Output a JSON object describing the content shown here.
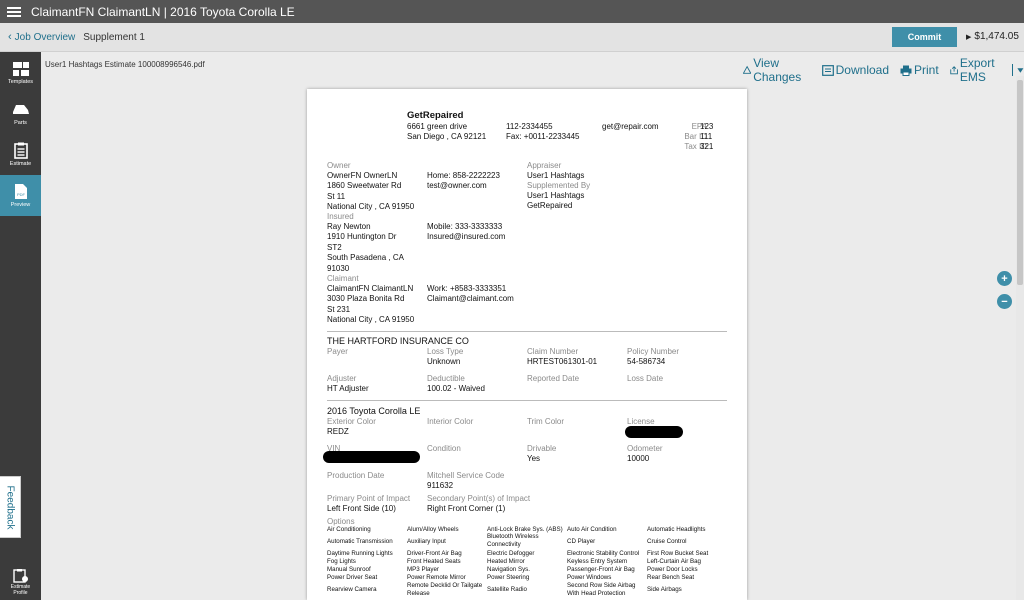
{
  "topbar": {
    "menu_icon": "hamburger-icon",
    "title": "ClaimantFN ClaimantLN | 2016 Toyota Corolla LE"
  },
  "subheader": {
    "back_label": "Job Overview",
    "supplement": "Supplement 1",
    "commit_label": "Commit",
    "total": "$1,474.05"
  },
  "sidebar": {
    "items": [
      {
        "label": "Templates",
        "icon": "templates-icon"
      },
      {
        "label": "Parts",
        "icon": "parts-icon"
      },
      {
        "label": "Estimate",
        "icon": "estimate-icon"
      },
      {
        "label": "Preview",
        "icon": "pdf-icon"
      }
    ],
    "bottom_label_1": "Estimate",
    "bottom_label_2": "Profile"
  },
  "docbar": {
    "filename": "User1 Hashtags Estimate 100008996546.pdf",
    "view_changes": "View Changes",
    "download": "Download",
    "print": "Print",
    "export": "Export EMS"
  },
  "doc": {
    "shop": {
      "name": "GetRepaired",
      "address1": "6661 green drive",
      "address2": "San Diego , CA 92121",
      "phone": "112-2334455",
      "fax": "Fax: +0011-2233445",
      "email": "get@repair.com",
      "epa_label": "EPA",
      "epa": "123",
      "bar_label": "Bar ID",
      "bar": "111",
      "tax_label": "Tax ID",
      "tax": "321"
    },
    "owner": {
      "label": "Owner",
      "name": "OwnerFN OwnerLN",
      "addr1": "1860 Sweetwater Rd",
      "addr2": "St 11",
      "city": "National City , CA 91950",
      "home": "Home: 858-2222223",
      "email": "test@owner.com"
    },
    "appraiser": {
      "label": "Appraiser",
      "name": "User1 Hashtags",
      "supp_label": "Supplemented By",
      "supp_name": "User1 Hashtags",
      "supp_shop": "GetRepaired"
    },
    "insured": {
      "label": "Insured",
      "name": "Ray Newton",
      "addr1": "1910 Huntington Dr",
      "addr2": "ST2",
      "city": "South Pasadena , CA",
      "zip": "91030",
      "mobile": "Mobile: 333-3333333",
      "email": "Insured@insured.com"
    },
    "claimant": {
      "label": "Claimant",
      "name": "ClaimantFN ClaimantLN",
      "addr1": "3030 Plaza Bonita Rd",
      "addr2": "St 231",
      "city": "National City , CA 91950",
      "work": "Work: +8583-3333351",
      "email": "Claimant@claimant.com"
    },
    "insurance": {
      "company": "THE HARTFORD INSURANCE CO",
      "payer_label": "Payer",
      "loss_type_label": "Loss Type",
      "loss_type": "Unknown",
      "claim_label": "Claim Number",
      "claim": "HRTEST061301-01",
      "policy_label": "Policy Number",
      "policy": "54-586734",
      "adjuster_label": "Adjuster",
      "adjuster": "HT Adjuster",
      "deductible_label": "Deductible",
      "deductible": "100.02 - Waived",
      "reported_label": "Reported Date",
      "loss_date_label": "Loss Date"
    },
    "vehicle": {
      "title": "2016 Toyota Corolla LE",
      "ext_color_label": "Exterior Color",
      "ext_color": "REDZ",
      "int_color_label": "Interior Color",
      "trim_label": "Trim Color",
      "license_label": "License",
      "vin_label": "VIN",
      "condition_label": "Condition",
      "drivable_label": "Drivable",
      "drivable": "Yes",
      "odometer_label": "Odometer",
      "odometer": "10000",
      "production_label": "Production Date",
      "msc_label": "Mitchell Service Code",
      "msc": "911632",
      "poi_label": "Primary Point of Impact",
      "poi": "Left Front Side (10)",
      "spoi_label": "Secondary Point(s) of Impact",
      "spoi": "Right Front Corner (1)",
      "options_label": "Options"
    },
    "options": [
      [
        "Air Conditioning",
        "Alum/Alloy Wheels",
        "Anti-Lock Brake Sys. (ABS)",
        "Auto Air Condition",
        "Automatic Headlights"
      ],
      [
        "Automatic Transmission",
        "Auxiliary Input",
        "Bluetooth Wireless Connectivity",
        "CD Player",
        "Cruise Control"
      ],
      [
        "Daytime Running Lights",
        "Driver-Front Air Bag",
        "Electric Defogger",
        "Electronic Stability Control",
        "First Row Bucket Seat"
      ],
      [
        "Fog Lights",
        "Front Heated Seats",
        "Heated Mirror",
        "Keyless Entry System",
        "Left-Curtain Air Bag"
      ],
      [
        "Manual Sunroof",
        "MP3 Player",
        "Navigation Sys.",
        "Passenger-Front Air Bag",
        "Power Door Locks"
      ],
      [
        "Power Driver Seat",
        "Power Remote Mirror",
        "Power Steering",
        "Power Windows",
        "Rear Bench Seat"
      ],
      [
        "Rearview Camera",
        "Remote Decklid Or Tailgate Release",
        "Satellite Radio",
        "Second Row Side Airbag With Head Protection",
        "Side Airbags"
      ]
    ]
  },
  "feedback": "Feedback",
  "colors": {
    "accent": "#3f8fa9",
    "link": "#1f6f8b",
    "topbar": "#555555",
    "sidebar": "#3b3b3b"
  }
}
